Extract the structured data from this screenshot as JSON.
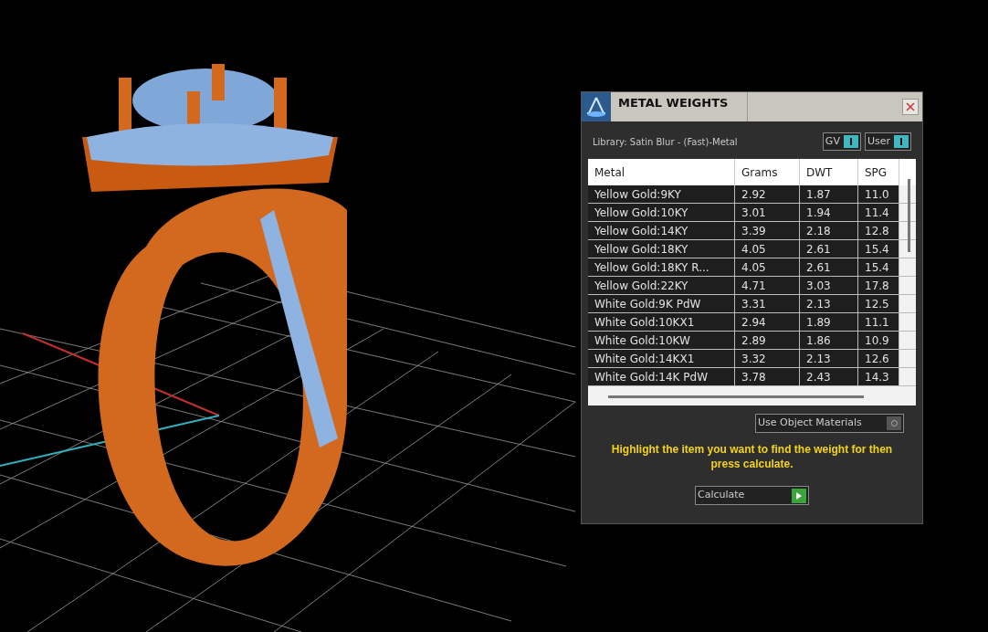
{
  "dialog": {
    "title": "METAL WEIGHTS",
    "library": "Library: Satin Blur - (Fast)-Metal",
    "toggles": [
      {
        "label": "GV",
        "on": true
      },
      {
        "label": "User",
        "on": true
      }
    ],
    "table": {
      "columns": [
        "Metal",
        "Grams",
        "DWT",
        "SPG"
      ],
      "rows": [
        [
          "Yellow Gold:9KY",
          "2.92",
          "1.87",
          "11.0"
        ],
        [
          "Yellow Gold:10KY",
          "3.01",
          "1.94",
          "11.4"
        ],
        [
          "Yellow Gold:14KY",
          "3.39",
          "2.18",
          "12.8"
        ],
        [
          "Yellow Gold:18KY",
          "4.05",
          "2.61",
          "15.4"
        ],
        [
          "Yellow Gold:18KY R...",
          "4.05",
          "2.61",
          "15.4"
        ],
        [
          "Yellow Gold:22KY",
          "4.71",
          "3.03",
          "17.8"
        ],
        [
          "White Gold:9K PdW",
          "3.31",
          "2.13",
          "12.5"
        ],
        [
          "White Gold:10KX1",
          "2.94",
          "1.89",
          "11.1"
        ],
        [
          "White Gold:10KW",
          "2.89",
          "1.86",
          "10.9"
        ],
        [
          "White Gold:14KX1",
          "3.32",
          "2.13",
          "12.6"
        ],
        [
          "White Gold:14K PdW",
          "3.78",
          "2.43",
          "14.3"
        ]
      ]
    },
    "use_object_materials": {
      "label": "Use Object Materials",
      "on": false
    },
    "hint": "Highlight the item you want to find the weight for then press calculate.",
    "calculate_button": "Calculate"
  }
}
